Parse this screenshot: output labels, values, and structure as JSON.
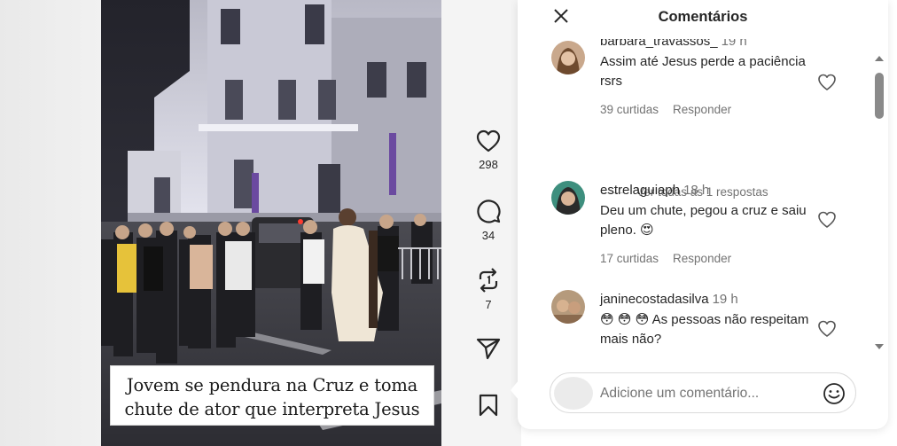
{
  "video": {
    "caption_line1": "Jovem se pendura na Cruz e toma",
    "caption_line2": "chute de ator que interpreta Jesus"
  },
  "actions": {
    "likes_count": "298",
    "comments_count": "34",
    "reposts_count": "7"
  },
  "panel": {
    "title": "Comentários",
    "composer_placeholder": "Adicione um comentário..."
  },
  "comments": [
    {
      "user": "barbara_travassos_",
      "time": "19 h",
      "text": "Assim até Jesus perde a paciência rsrs",
      "likes": "39 curtidas",
      "reply_label": "Responder"
    },
    {
      "user": "estrelaguiaph",
      "time": "18 h",
      "text": "Deu um chute, pegou a cruz e saiu pleno. 😍",
      "likes": "17 curtidas",
      "reply_label": "Responder"
    },
    {
      "user": "janinecostadasilva",
      "time": "19 h",
      "text": "😳 😳 😳  As pessoas não respeitam mais não?",
      "likes": "",
      "reply_label": ""
    }
  ],
  "replies_link": "Ver todas as 1 respostas",
  "colors": {
    "text": "#262626",
    "muted": "#737373",
    "panel_bg": "#ffffff"
  }
}
